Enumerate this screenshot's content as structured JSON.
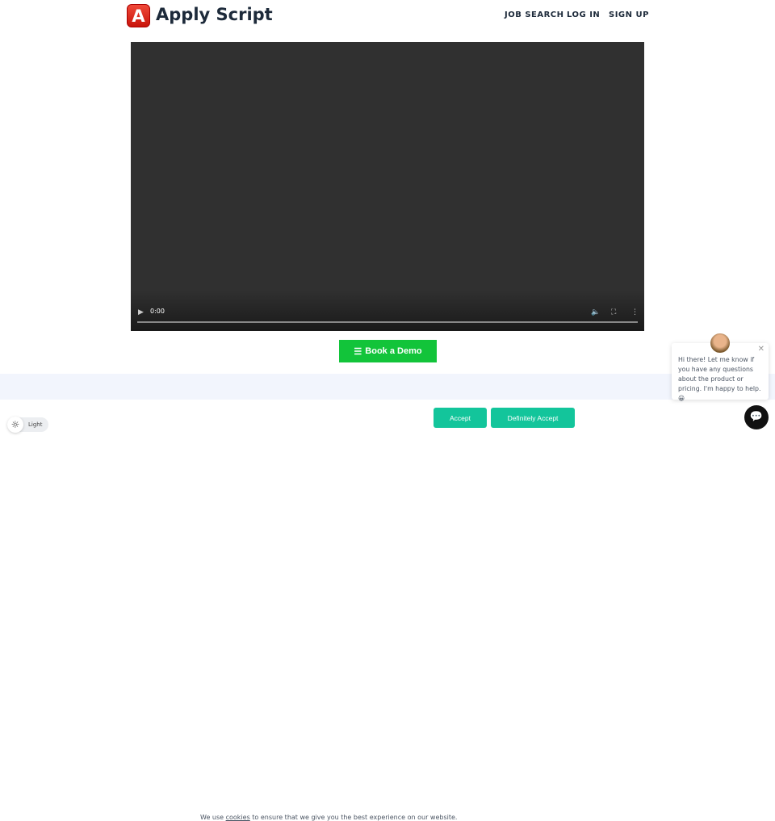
{
  "header": {
    "logo_letter": "A",
    "brand": "Apply Script",
    "nav": [
      "JOB SEARCH",
      "LOG IN",
      "SIGN UP"
    ]
  },
  "video": {
    "time": "0:00",
    "icons": [
      "play-icon",
      "volume-icon",
      "fullscreen-icon",
      "more-icon"
    ]
  },
  "demo_button": "Book a Demo",
  "cookie": {
    "text_before": "We use ",
    "link": "cookies",
    "text_after": " to ensure that we give you the best experience on our website.",
    "accept": "Accept",
    "definitely_accept": "Definitely Accept"
  },
  "theme_toggle": {
    "label": "Light"
  },
  "chat": {
    "message": "Hi there! Let me know if you have any questions about the product or pricing. I'm happy to help. 😀"
  },
  "colors": {
    "accent_green": "#12c43a",
    "cookie_button": "#13c59b",
    "brand_text": "#1d2a3a"
  }
}
